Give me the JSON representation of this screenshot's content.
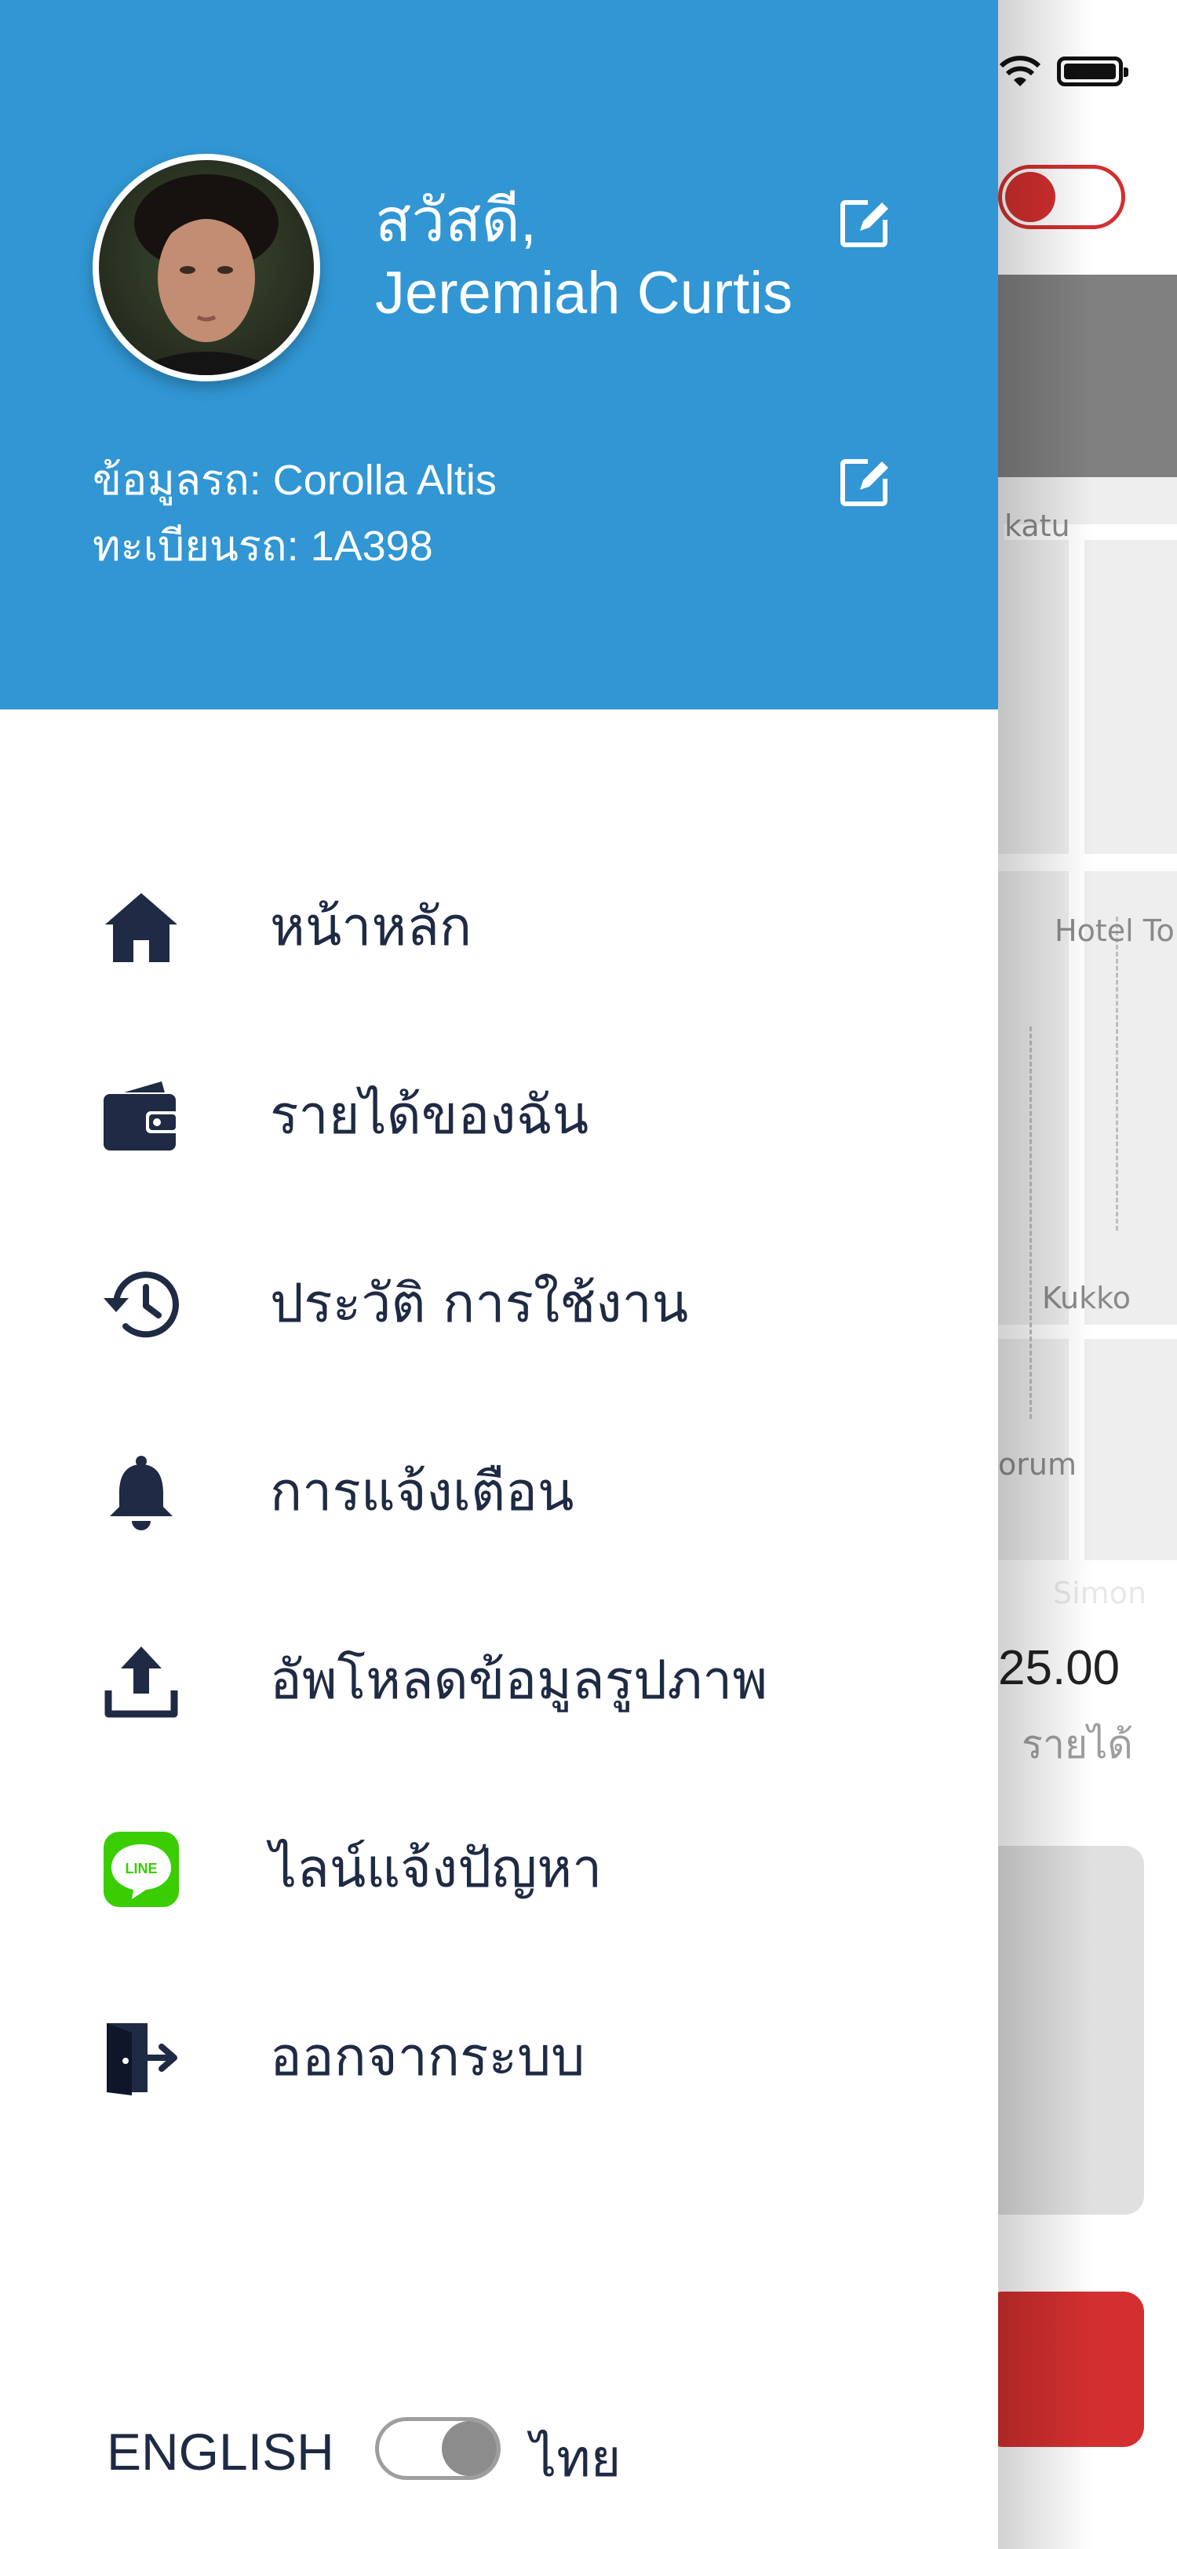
{
  "header": {
    "greeting_line1": "สวัสดี,",
    "greeting_line2": "Jeremiah Curtis",
    "car_model": "ข้อมูลรถ: Corolla Altis",
    "plate": "ทะเบียนรถ: 1A398",
    "background_color": "#3196d3"
  },
  "menu": {
    "items": [
      {
        "icon": "home-icon",
        "label": "หน้าหลัก"
      },
      {
        "icon": "wallet-icon",
        "label": "รายได้ของฉัน"
      },
      {
        "icon": "history-icon",
        "label": "ประวัติ การใช้งาน"
      },
      {
        "icon": "bell-icon",
        "label": "การแจ้งเตือน"
      },
      {
        "icon": "upload-icon",
        "label": "อัพโหลดข้อมูลรูปภาพ"
      },
      {
        "icon": "line-icon",
        "label": "ไลน์แจ้งปัญหา"
      },
      {
        "icon": "logout-icon",
        "label": "ออกจากระบบ"
      }
    ]
  },
  "language": {
    "english_label": "ENGLISH",
    "thai_label": "ไทย",
    "selected": "ไทย"
  },
  "background_screen": {
    "map_labels": [
      "katu",
      "Hotel To",
      "Kukko",
      "orum",
      "Simon"
    ],
    "amount": "25.00",
    "amount_label": "รายได้",
    "accent_color": "#d32f2f"
  }
}
